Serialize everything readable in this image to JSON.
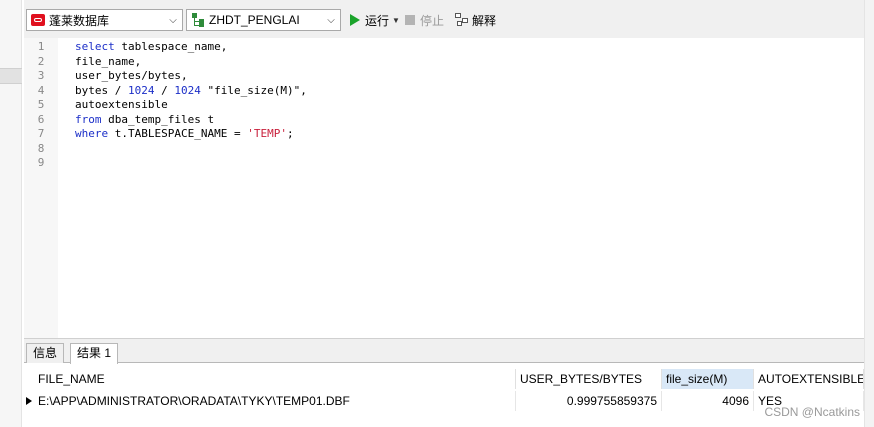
{
  "toolbar": {
    "connection": "蓬莱数据库",
    "schema": "ZHDT_PENGLAI",
    "run_label": "运行",
    "stop_label": "停止",
    "explain_label": "解释"
  },
  "editor": {
    "line_numbers": [
      "1",
      "2",
      "3",
      "4",
      "5",
      "6",
      "7",
      "8",
      "9"
    ],
    "lines": [
      [
        {
          "t": "select",
          "c": "kw"
        },
        {
          "t": " tablespace_name,",
          "c": ""
        }
      ],
      [
        {
          "t": "file_name,",
          "c": ""
        }
      ],
      [
        {
          "t": "user_bytes/bytes,",
          "c": ""
        }
      ],
      [
        {
          "t": "bytes / ",
          "c": ""
        },
        {
          "t": "1024",
          "c": "nm"
        },
        {
          "t": " / ",
          "c": ""
        },
        {
          "t": "1024",
          "c": "nm"
        },
        {
          "t": " \"file_size(M)\",",
          "c": ""
        }
      ],
      [
        {
          "t": "autoextensible",
          "c": ""
        }
      ],
      [
        {
          "t": "from",
          "c": "kw"
        },
        {
          "t": " dba_temp_files t",
          "c": ""
        }
      ],
      [
        {
          "t": "where",
          "c": "kw"
        },
        {
          "t": " t.TABLESPACE_NAME = ",
          "c": ""
        },
        {
          "t": "'TEMP'",
          "c": "st"
        },
        {
          "t": ";",
          "c": ""
        }
      ],
      [],
      []
    ]
  },
  "results": {
    "tabs": [
      {
        "label": "信息"
      },
      {
        "label": "结果 1"
      }
    ],
    "columns": [
      "FILE_NAME",
      "USER_BYTES/BYTES",
      "file_size(M)",
      "AUTOEXTENSIBLE"
    ],
    "rows": [
      [
        "E:\\APP\\ADMINISTRATOR\\ORADATA\\TYKY\\TEMP01.DBF",
        "0.999755859375",
        "4096",
        "YES"
      ]
    ]
  },
  "watermark": "CSDN @Ncatkins"
}
